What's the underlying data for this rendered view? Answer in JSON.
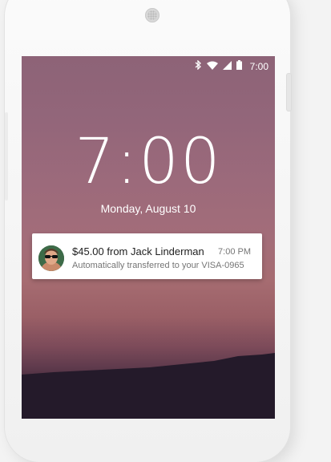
{
  "status_bar": {
    "time": "7:00",
    "icons": [
      "bluetooth-icon",
      "wifi-icon",
      "signal-icon",
      "battery-icon"
    ]
  },
  "lockscreen": {
    "clock": "7:00",
    "date": "Monday, August 10"
  },
  "notification": {
    "title": "$45.00 from Jack Linderman",
    "time": "7:00 PM",
    "text": "Automatically transferred to your VISA-0965"
  },
  "colors": {
    "accent": "#ffffff",
    "wallpaper_top": "#8d6377",
    "wallpaper_bottom": "#2a1c2c"
  }
}
